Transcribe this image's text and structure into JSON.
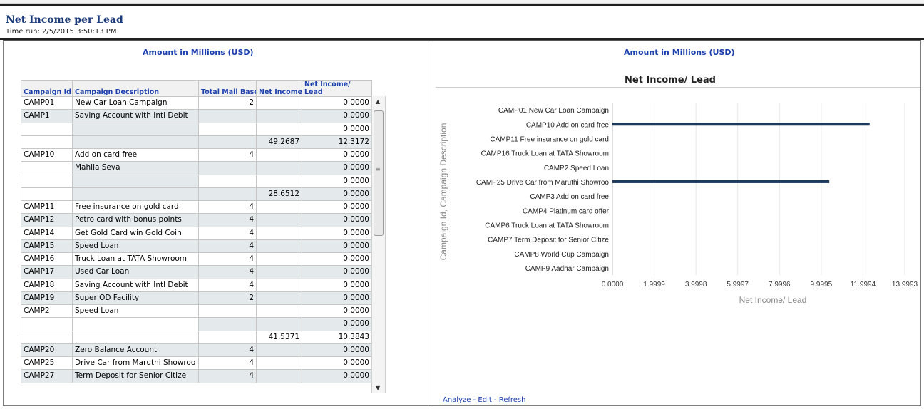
{
  "report": {
    "title": "Net Income per Lead",
    "time_run": "Time run: 2/5/2015 3:50:13 PM"
  },
  "left_panel": {
    "subtitle": "Amount in Millions (USD)",
    "columns": {
      "campaign_id": "Campaign Id",
      "description": "Campaign Decsription",
      "mail_base": "Total Mail Base",
      "net_income": "Net Income",
      "nil_line1": "Net Income/",
      "nil_line2": "Lead"
    },
    "rows": [
      {
        "id": "CAMP01",
        "desc": "New Car Loan Campaign",
        "mail": "2",
        "income": "",
        "per_lead": "0.0000",
        "shade": "white"
      },
      {
        "id": "CAMP1",
        "desc": "Saving Account with Intl Debit",
        "mail": "",
        "income": "",
        "per_lead": "0.0000",
        "shade": "gray"
      },
      {
        "id": "",
        "desc": "",
        "mail": "",
        "income": "",
        "per_lead": "0.0000",
        "shade": "white"
      },
      {
        "id": "",
        "desc": "",
        "mail": "",
        "income": "49.2687",
        "per_lead": "12.3172",
        "shade": "gray"
      },
      {
        "id": "CAMP10",
        "desc": "Add on card free",
        "mail": "4",
        "income": "",
        "per_lead": "0.0000",
        "shade": "white"
      },
      {
        "id": "",
        "desc": "Mahila Seva",
        "mail": "",
        "income": "",
        "per_lead": "0.0000",
        "shade": "gray"
      },
      {
        "id": "",
        "desc": "",
        "mail": "",
        "income": "",
        "per_lead": "0.0000",
        "shade": "white"
      },
      {
        "id": "",
        "desc": "",
        "mail": "",
        "income": "28.6512",
        "per_lead": "0.0000",
        "shade": "gray"
      },
      {
        "id": "CAMP11",
        "desc": "Free insurance on gold card",
        "mail": "4",
        "income": "",
        "per_lead": "0.0000",
        "shade": "white"
      },
      {
        "id": "CAMP12",
        "desc": "Petro card with bonus points",
        "mail": "4",
        "income": "",
        "per_lead": "0.0000",
        "shade": "gray"
      },
      {
        "id": "CAMP14",
        "desc": "Get Gold Card win Gold Coin",
        "mail": "4",
        "income": "",
        "per_lead": "0.0000",
        "shade": "white"
      },
      {
        "id": "CAMP15",
        "desc": "Speed Loan",
        "mail": "4",
        "income": "",
        "per_lead": "0.0000",
        "shade": "gray"
      },
      {
        "id": "CAMP16",
        "desc": "Truck Loan at TATA Showroom",
        "mail": "4",
        "income": "",
        "per_lead": "0.0000",
        "shade": "white"
      },
      {
        "id": "CAMP17",
        "desc": "Used Car Loan",
        "mail": "4",
        "income": "",
        "per_lead": "0.0000",
        "shade": "gray"
      },
      {
        "id": "CAMP18",
        "desc": "Saving Account with Intl Debit",
        "mail": "4",
        "income": "",
        "per_lead": "0.0000",
        "shade": "white"
      },
      {
        "id": "CAMP19",
        "desc": "Super OD Facility",
        "mail": "2",
        "income": "",
        "per_lead": "0.0000",
        "shade": "gray"
      },
      {
        "id": "CAMP2",
        "desc": "Speed Loan",
        "mail": "",
        "income": "",
        "per_lead": "0.0000",
        "shade": "white"
      },
      {
        "id": "",
        "desc": "",
        "mail": "",
        "income": "",
        "per_lead": "0.0000",
        "shade": "gray"
      },
      {
        "id": "",
        "desc": "",
        "mail": "",
        "income": "41.5371",
        "per_lead": "10.3843",
        "shade": "white"
      },
      {
        "id": "CAMP20",
        "desc": "Zero Balance Account",
        "mail": "4",
        "income": "",
        "per_lead": "0.0000",
        "shade": "gray"
      },
      {
        "id": "CAMP25",
        "desc": "Drive Car from Maruthi Showroo",
        "mail": "4",
        "income": "",
        "per_lead": "0.0000",
        "shade": "white"
      },
      {
        "id": "CAMP27",
        "desc": "Term Deposit for Senior Citize",
        "mail": "4",
        "income": "",
        "per_lead": "0.0000",
        "shade": "gray"
      }
    ]
  },
  "right_panel": {
    "subtitle": "Amount in Millions (USD)"
  },
  "chart_data": {
    "type": "bar",
    "orientation": "horizontal",
    "title": "Net Income/ Lead",
    "xlabel": "Net Income/ Lead",
    "ylabel": "Campaign Id, Campaign Description",
    "categories": [
      "CAMP01 New Car Loan Campaign",
      "CAMP10 Add on card free",
      "CAMP11 Free insurance on gold card",
      "CAMP16 Truck Loan at TATA Showroom",
      "CAMP2 Speed Loan",
      "CAMP25 Drive Car from Maruthi Showroo",
      "CAMP3 Add on card free",
      "CAMP4 Platinum card offer",
      "CAMP6 Truck Loan at TATA Showroom",
      "CAMP7 Term Deposit for Senior Citize",
      "CAMP8 World Cup Campaign",
      "CAMP9 Aadhar Campaign"
    ],
    "values": [
      0,
      12.3172,
      0,
      0,
      0,
      10.3843,
      0,
      0,
      0,
      0,
      0,
      0
    ],
    "xticks": [
      "0.0000",
      "1.9999",
      "3.9998",
      "5.9997",
      "7.9996",
      "9.9995",
      "11.9994",
      "13.9993"
    ],
    "xlim": [
      0,
      13.9993
    ],
    "grid": true,
    "bar_color": "#1b3a5c"
  },
  "links": {
    "analyze": "Analyze",
    "edit": "Edit",
    "refresh": "Refresh",
    "sep": " - "
  }
}
